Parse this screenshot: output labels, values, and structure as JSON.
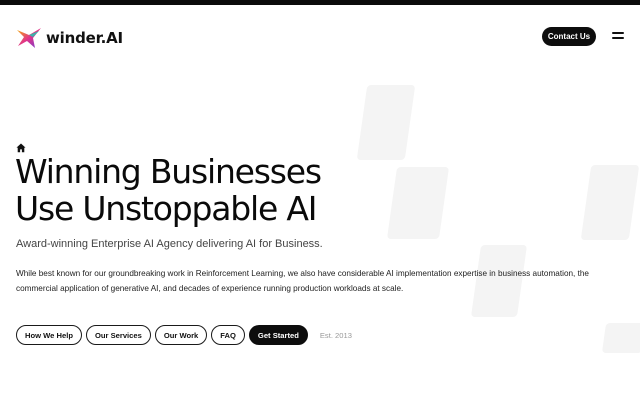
{
  "brand": {
    "name": "winder.AI",
    "colors": {
      "gradient_start": "#f5b400",
      "gradient_mid": "#e0338a",
      "gradient_end": "#6a3fd8",
      "dark": "#0d0d0d"
    }
  },
  "header": {
    "contact_label": "Contact Us",
    "menu_icon": "hamburger-menu-icon"
  },
  "hero": {
    "breadcrumb_icon": "home-icon",
    "title_line1": "Winning Businesses",
    "title_line2": "Use Unstoppable AI",
    "subtitle": "Award-winning Enterprise AI Agency delivering AI for Business.",
    "description": "While best known for our groundbreaking work in Reinforcement Learning, we also have considerable AI implementation expertise in business automation, the commercial application of generative AI, and decades of experience running production workloads at scale."
  },
  "actions": {
    "how_we_help": "How We Help",
    "our_services": "Our Services",
    "our_work": "Our Work",
    "faq": "FAQ",
    "get_started": "Get Started",
    "established": "Est. 2013"
  }
}
